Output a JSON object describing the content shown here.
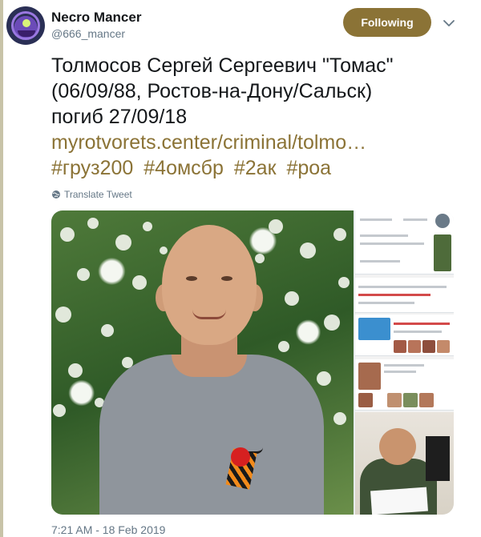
{
  "author": {
    "display_name": "Necro Mancer",
    "handle": "@666_mancer"
  },
  "follow_button": {
    "label": "Following"
  },
  "tweet": {
    "text_line1": "Толмосов Сергей Сергеевич \"Томас\"",
    "text_line2": "(06/09/88, Ростов-на-Дону/Сальск)",
    "text_line3": "погиб 27/09/18",
    "link": "myrotvorets.center/criminal/tolmo…",
    "hashtags": [
      "#груз200",
      "#4омсбр",
      "#2ак",
      "#роа"
    ]
  },
  "translate": {
    "label": "Translate Tweet"
  },
  "timestamp": "7:21 AM - 18 Feb 2019",
  "colors": {
    "accent": "#8b7336",
    "thread_line": "#c8c3a8",
    "secondary_text": "#657786"
  },
  "icons": {
    "caret": "chevron-down-icon",
    "translate": "globe-icon"
  }
}
